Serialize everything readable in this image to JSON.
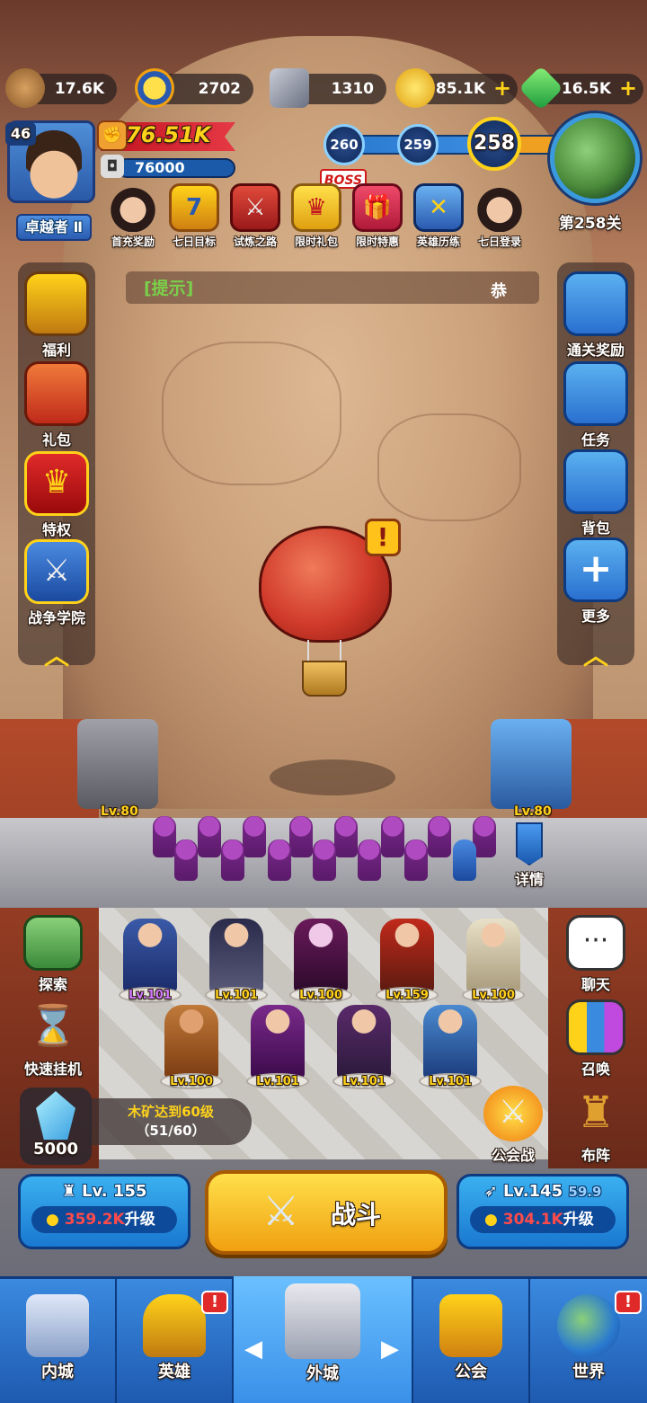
{
  "resources": [
    {
      "icon": "wood-log-icon",
      "value": "17.6K",
      "has_plus": false
    },
    {
      "icon": "gold-medal-icon",
      "value": "2702",
      "has_plus": false
    },
    {
      "icon": "iron-ore-icon",
      "value": "1310",
      "has_plus": false
    },
    {
      "icon": "gold-coin-icon",
      "value": "85.1K",
      "has_plus": true
    },
    {
      "icon": "green-gem-icon",
      "value": "16.5K",
      "has_plus": true
    }
  ],
  "player": {
    "level": "46",
    "title": "卓越者 Ⅱ",
    "power": "76.51K",
    "exp": "76000"
  },
  "progress": {
    "prev_stage_2": "260",
    "prev_stage_1": "259",
    "current_stage": "258",
    "boss_label": "BOSS",
    "stage_label": "第258关"
  },
  "events": [
    {
      "icon": "girl-portrait-icon",
      "label": "首充奖励"
    },
    {
      "icon": "seven-day-shield-icon",
      "label": "七日目标"
    },
    {
      "icon": "crossed-swords-banner-icon",
      "label": "试炼之路"
    },
    {
      "icon": "crown-gift-icon",
      "label": "限时礼包"
    },
    {
      "icon": "gift-box-icon",
      "label": "限时特惠"
    },
    {
      "icon": "hero-shield-icon",
      "label": "英雄历练"
    },
    {
      "icon": "girl-portrait-icon",
      "label": "七日登录"
    }
  ],
  "hint": {
    "label": "[提示]",
    "tail": "恭"
  },
  "left_menu": [
    {
      "icon": "crown-badge-icon",
      "label": "福利"
    },
    {
      "icon": "gift-pack-icon",
      "label": "礼包"
    },
    {
      "icon": "crown-shield-icon",
      "label": "特权"
    },
    {
      "icon": "crossed-swords-shield-icon",
      "label": "战争学院"
    }
  ],
  "right_menu": [
    {
      "icon": "gift-ribbon-icon",
      "label": "通关奖励"
    },
    {
      "icon": "scroll-icon",
      "label": "任务"
    },
    {
      "icon": "backpack-icon",
      "label": "背包"
    },
    {
      "icon": "plus-cross-icon",
      "label": "更多"
    }
  ],
  "towers": {
    "left_level": "Lv.80",
    "right_level": "Lv.80"
  },
  "details_label": "详情",
  "heroes_row1": [
    "Lv.101",
    "Lv.101",
    "Lv.100",
    "Lv.159",
    "Lv.100"
  ],
  "heroes_row2": [
    "Lv.100",
    "Lv.101",
    "Lv.101",
    "Lv.101"
  ],
  "left_actions": [
    {
      "icon": "map-flag-icon",
      "label": "探索"
    },
    {
      "icon": "hourglass-icon",
      "label": "快速挂机"
    }
  ],
  "right_actions": [
    {
      "icon": "chat-bubble-icon",
      "label": "聊天"
    },
    {
      "icon": "summon-cards-icon",
      "label": "召唤"
    },
    {
      "icon": "guild-war-swords-icon",
      "label": "公会战"
    },
    {
      "icon": "chess-rook-icon",
      "label": "布阵"
    }
  ],
  "crystal": {
    "value": "5000"
  },
  "quest": {
    "title": "木矿达到60级",
    "progress": "（51/60）"
  },
  "upgrade_left": {
    "level": "Lv. 155",
    "cost": "359.2K",
    "action": "升级"
  },
  "upgrade_right": {
    "level": "Lv.145",
    "bonus": "59.9",
    "cost": "304.1K",
    "action": "升级"
  },
  "battle_label": "战斗",
  "nav": [
    {
      "icon": "castle-icon",
      "label": "内城",
      "badge": ""
    },
    {
      "icon": "hero-helmet-icon",
      "label": "英雄",
      "badge": "!"
    },
    {
      "icon": "outer-castle-icon",
      "label": "外城",
      "badge": ""
    },
    {
      "icon": "handshake-shield-icon",
      "label": "公会",
      "badge": ""
    },
    {
      "icon": "globe-icon",
      "label": "世界",
      "badge": "!"
    }
  ],
  "colors": {
    "gold": "#ffd21a",
    "blue_button": "#1a78d0",
    "nav_blue": "#1e5ab0",
    "power_red": "#e63946",
    "hint_green": "#7ad04a"
  }
}
